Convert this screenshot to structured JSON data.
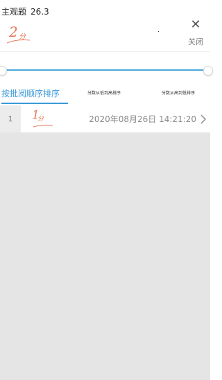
{
  "header": {
    "title": "主观题",
    "score": "26.3",
    "stamp_num": "2",
    "stamp_unit": "分",
    "close_label": "关闭",
    "close_icon": "close-icon"
  },
  "slider": {
    "range": [
      0,
      1
    ]
  },
  "tabs": [
    {
      "label": "按批阅顺序排序",
      "active": true
    },
    {
      "label": "分数从低到高排序",
      "active": false
    },
    {
      "label": "分数从高到低排序",
      "active": false
    }
  ],
  "list": {
    "items": [
      {
        "index": "1",
        "stamp_num": "1",
        "stamp_unit": "分",
        "time": "2020年08月26日 14:21:20",
        "icon": "chevron-right-icon"
      }
    ]
  },
  "colors": {
    "accent": "#3a9ad9",
    "stamp": "#e57a5a",
    "empty_bg": "#e5e5e5"
  }
}
